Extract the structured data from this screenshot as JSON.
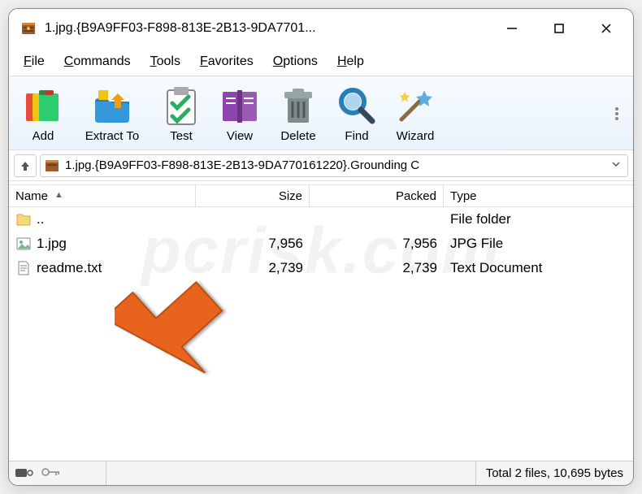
{
  "window": {
    "title": "1.jpg.{B9A9FF03-F898-813E-2B13-9DA7701..."
  },
  "menu": {
    "items": [
      "File",
      "Commands",
      "Tools",
      "Favorites",
      "Options",
      "Help"
    ]
  },
  "toolbar": {
    "add": "Add",
    "extract": "Extract To",
    "test": "Test",
    "view": "View",
    "delete": "Delete",
    "find": "Find",
    "wizard": "Wizard"
  },
  "address": {
    "path": "1.jpg.{B9A9FF03-F898-813E-2B13-9DA770161220}.Grounding C"
  },
  "columns": {
    "name": "Name",
    "size": "Size",
    "packed": "Packed",
    "type": "Type"
  },
  "files": [
    {
      "name": "..",
      "size": "",
      "packed": "",
      "type": "File folder",
      "icon": "folder"
    },
    {
      "name": "1.jpg",
      "size": "7,956",
      "packed": "7,956",
      "type": "JPG File",
      "icon": "image"
    },
    {
      "name": "readme.txt",
      "size": "2,739",
      "packed": "2,739",
      "type": "Text Document",
      "icon": "text"
    }
  ],
  "status": {
    "summary": "Total 2 files, 10,695 bytes"
  },
  "watermark": "pcrisk.com"
}
